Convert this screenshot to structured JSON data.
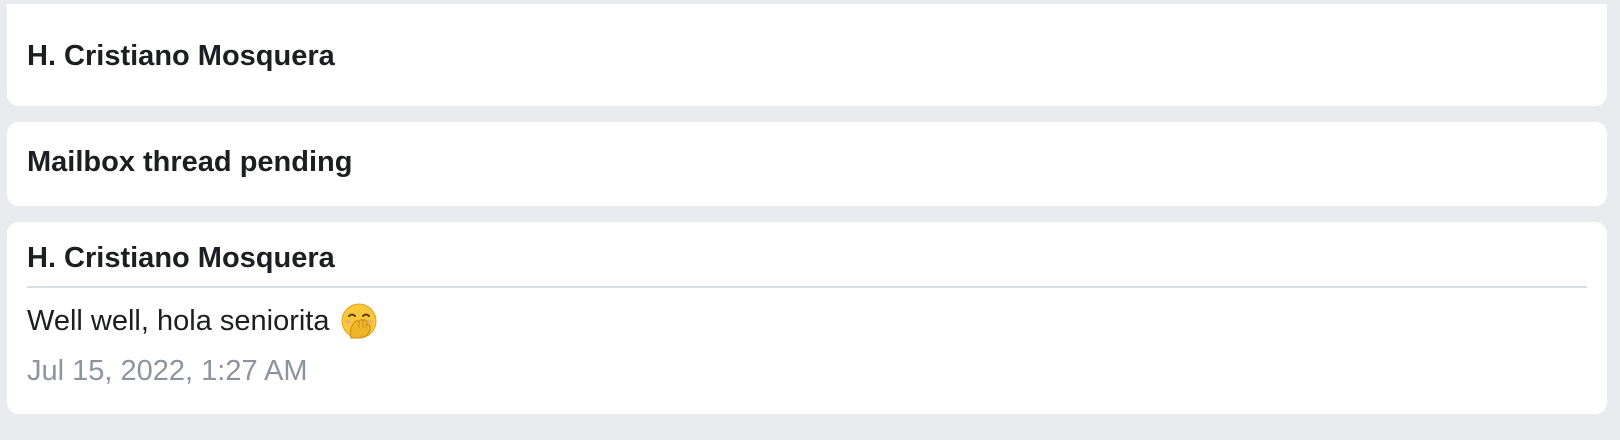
{
  "cards": [
    {
      "title": "H. Cristiano Mosquera"
    },
    {
      "title": "Mailbox thread pending"
    },
    {
      "title": "H. Cristiano Mosquera",
      "message": "Well well, hola seniorita",
      "emoji_icon": "face-with-hand-over-mouth-icon",
      "timestamp": "Jul 15, 2022, 1:27 AM"
    }
  ],
  "colors": {
    "background": "#e9ebee",
    "card": "#ffffff",
    "text": "#1c1e21",
    "timestamp": "#8d949e",
    "divider": "#dadde1"
  }
}
